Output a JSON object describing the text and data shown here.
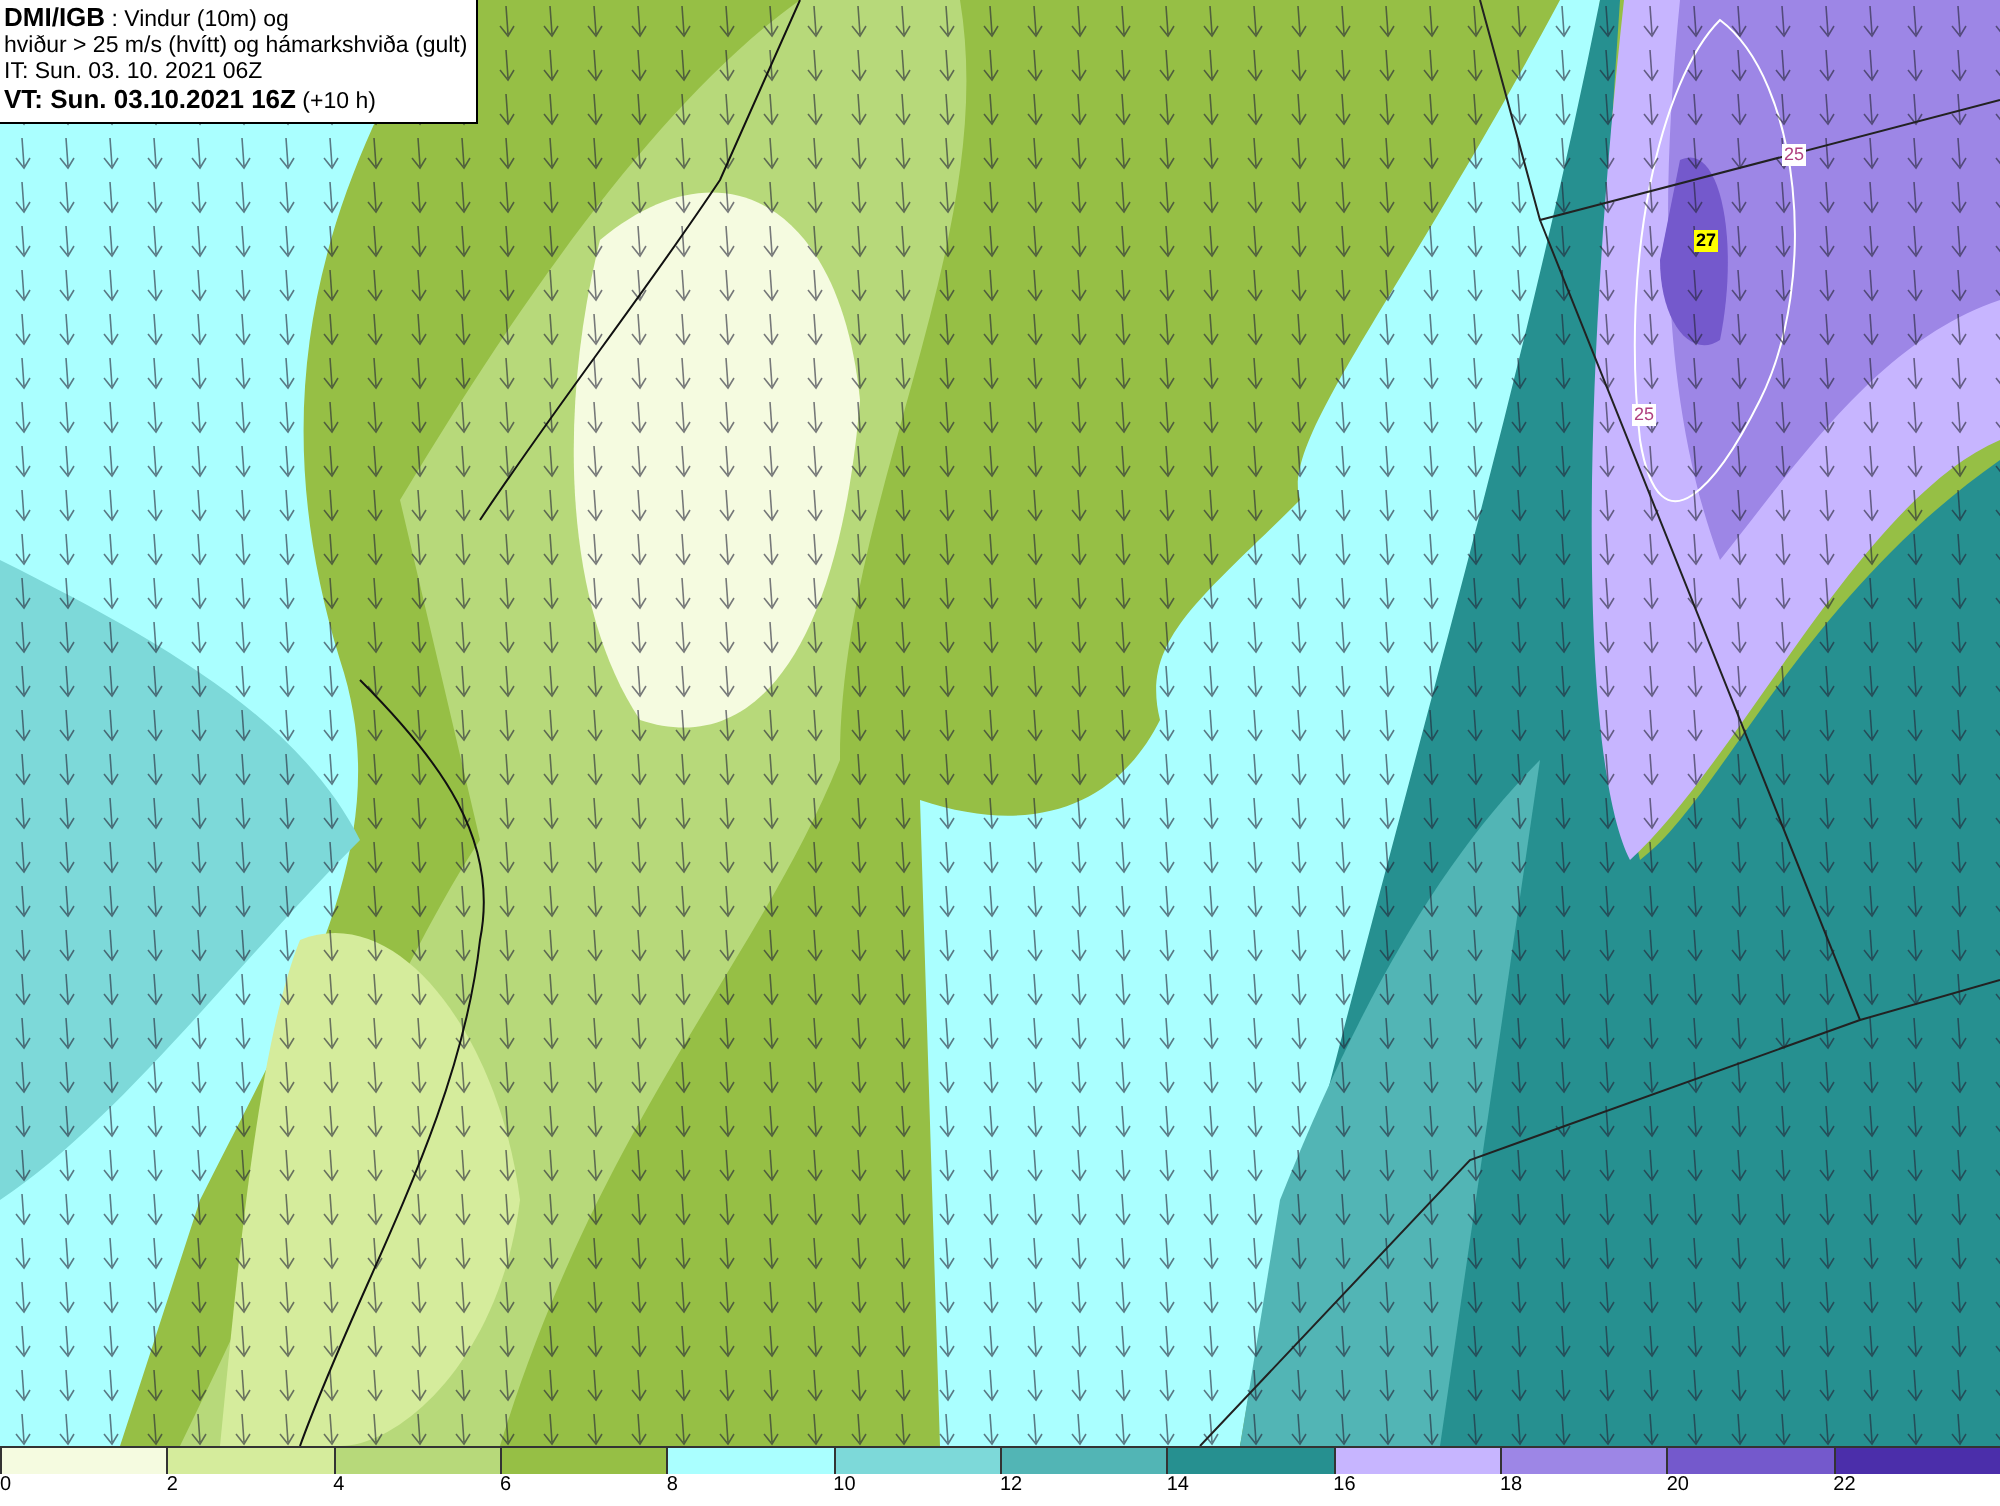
{
  "header": {
    "lines": [
      "**DMI/IGB** : Vindur (10m) og",
      "hviður > 25 m/s (hvítt) og hámarkshviða (gult)",
      "IT: Sun. 03. 10. 2021 06Z",
      "**VT: Sun. 03.10.2021 16Z** (+10 h)"
    ]
  },
  "map": {
    "labels": [
      {
        "text": "25",
        "kind": "gust"
      },
      {
        "text": "27",
        "kind": "max"
      },
      {
        "text": "25",
        "kind": "gust"
      }
    ]
  },
  "legend": {
    "bins": [
      {
        "color": "#f5fbe0"
      },
      {
        "color": "#d5ec9c"
      },
      {
        "color": "#b7d97a"
      },
      {
        "color": "#96bf45"
      },
      {
        "color": "#aaffff"
      },
      {
        "color": "#7dd9d9"
      },
      {
        "color": "#52b5b5"
      },
      {
        "color": "#269090"
      },
      {
        "color": "#c7b5ff"
      },
      {
        "color": "#9d86e6"
      },
      {
        "color": "#7459cc"
      },
      {
        "color": "#4b2eaa"
      }
    ],
    "ticks": [
      "0",
      "2",
      "4",
      "6",
      "8",
      "10",
      "12",
      "14",
      "16",
      "18",
      "20",
      "22"
    ]
  }
}
